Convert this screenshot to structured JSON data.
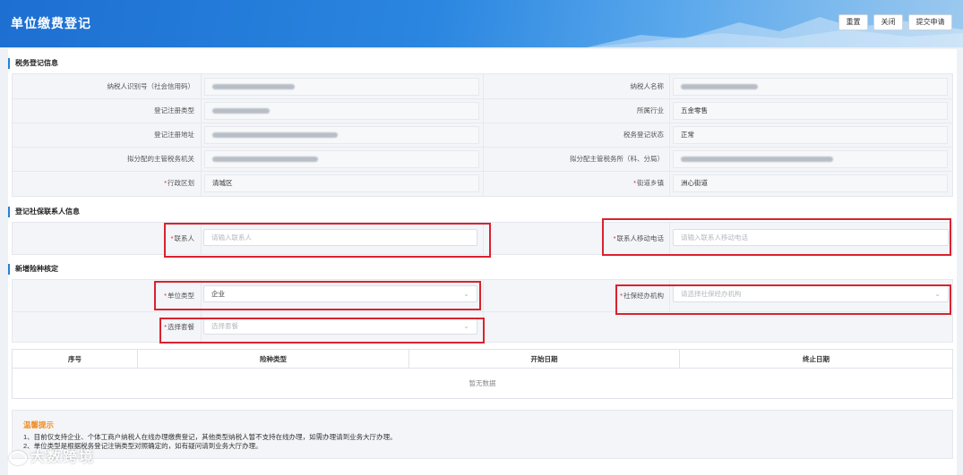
{
  "header": {
    "title": "单位缴费登记",
    "buttons": {
      "reset": "重置",
      "close": "关闭",
      "submit": "提交申请"
    }
  },
  "tax_info": {
    "section_title": "税务登记信息",
    "rows": [
      {
        "left_label": "纳税人识别号（社会信用码）",
        "left_value": "",
        "right_label": "纳税人名称",
        "right_value": ""
      },
      {
        "left_label": "登记注册类型",
        "left_value": "",
        "right_label": "所属行业",
        "right_value": "五金零售"
      },
      {
        "left_label": "登记注册地址",
        "left_value": "",
        "right_label": "税务登记状态",
        "right_value": "正常"
      },
      {
        "left_label": "拟分配的主管税务机关",
        "left_value": "",
        "right_label": "拟分配主管税务所（科、分局）",
        "right_value": ""
      },
      {
        "left_label": "行政区划",
        "left_value": "清城区",
        "right_label": "街道乡镇",
        "right_value": "洲心街道"
      }
    ],
    "required_mark": "*"
  },
  "contact": {
    "section_title": "登记社保联系人信息",
    "contact_label": "联系人",
    "contact_placeholder": "请输入联系人",
    "phone_label": "联系人移动电话",
    "phone_placeholder": "请输入联系人移动电话"
  },
  "insurance": {
    "section_title": "新增险种核定",
    "unit_type_label": "单位类型",
    "unit_type_value": "企业",
    "agency_label": "社保经办机构",
    "agency_placeholder": "请选择社保经办机构",
    "package_label": "选择套餐",
    "package_placeholder": "选择套餐"
  },
  "table": {
    "columns": [
      "序号",
      "险种类型",
      "开始日期",
      "终止日期"
    ],
    "empty_text": "暂无数据"
  },
  "tips": {
    "title": "温馨提示",
    "lines": [
      "1、目前仅支持企业、个体工商户纳税人在线办理缴费登记，其他类型纳税人暂不支持在线办理，如需办理请到业务大厅办理。",
      "2、单位类型是根据税务登记注销类型对照确定的，如有疑问请到业务大厅办理。"
    ]
  },
  "watermark": "大数跨境",
  "colors": {
    "accent": "#2a7fd4",
    "required": "#e02020",
    "highlight": "#d9232e",
    "tip_title": "#f08c1e"
  }
}
